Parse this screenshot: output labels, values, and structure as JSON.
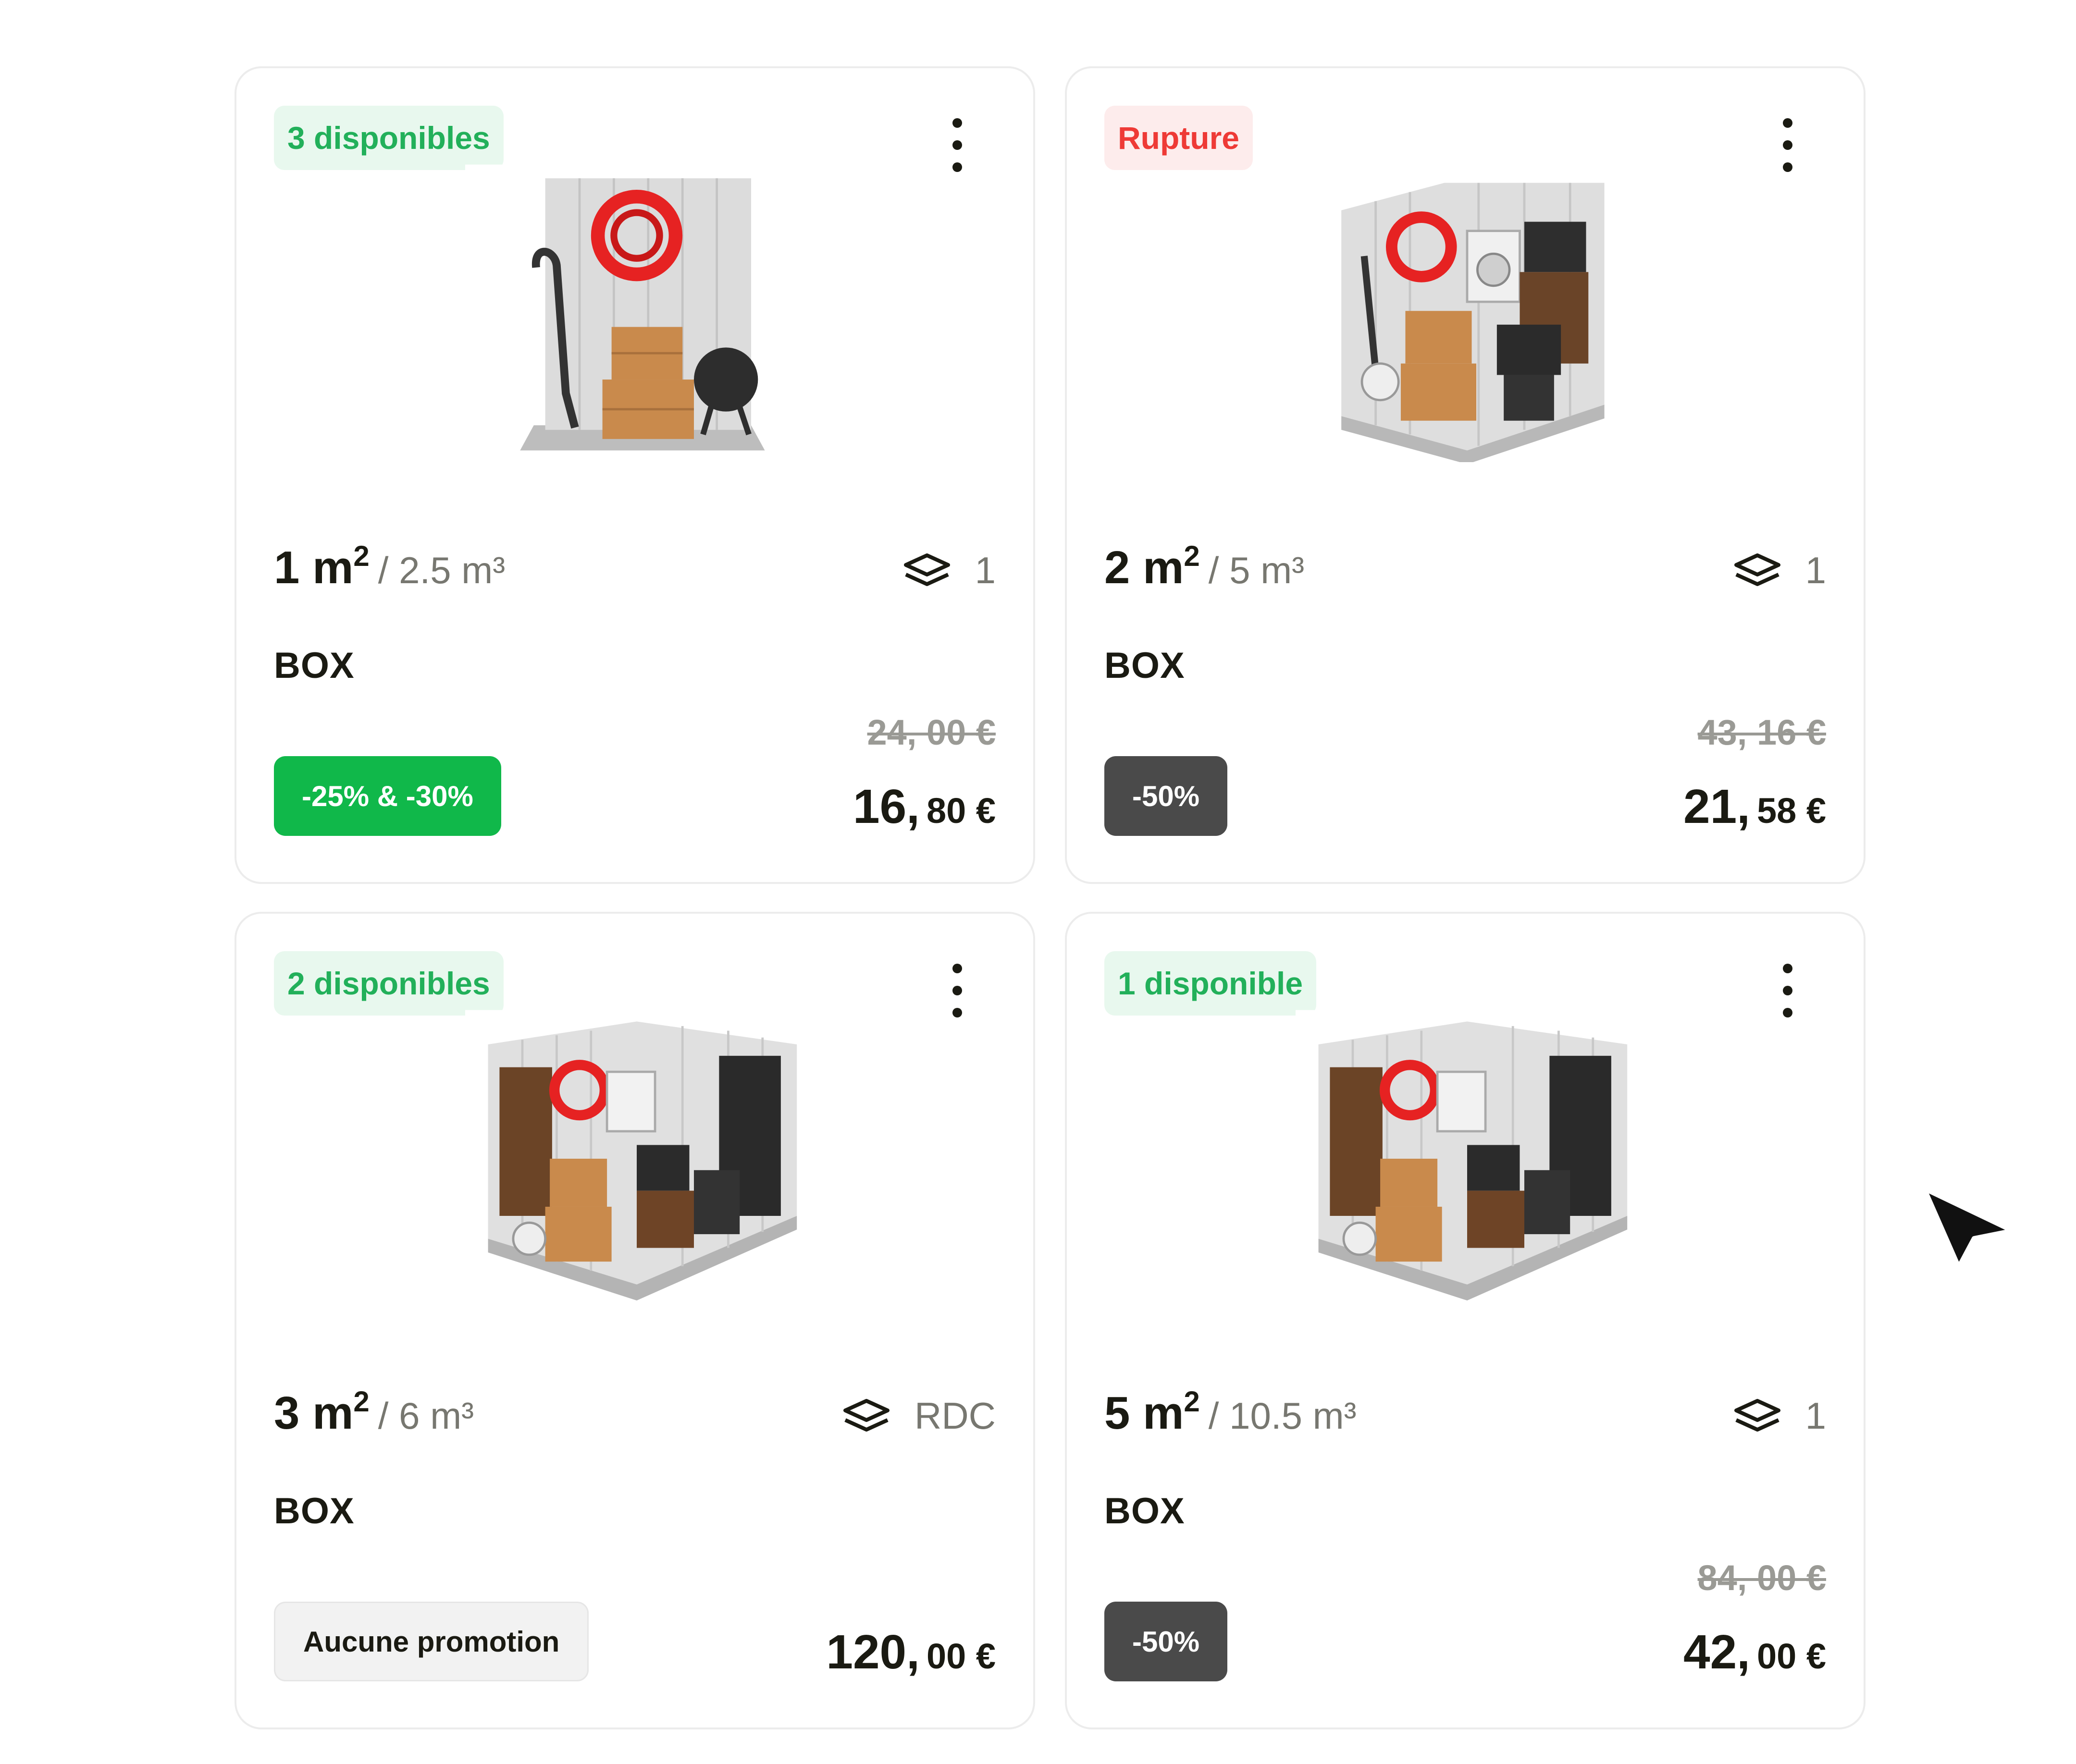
{
  "cards": [
    {
      "badge": "3 disponibles",
      "badge_status": "available",
      "area": "1 m",
      "area_sup": "2",
      "volume": "/ 2.5 m³",
      "level": "1",
      "type": "BOX",
      "old_price": "24, 00 €",
      "price_int": "16,",
      "price_dec": "80 €",
      "promo": "-25% & -30%",
      "promo_style": "green"
    },
    {
      "badge": "Rupture",
      "badge_status": "rupture",
      "area": "2 m",
      "area_sup": "2",
      "volume": "/ 5 m³",
      "level": "1",
      "type": "BOX",
      "old_price": "43, 16 €",
      "price_int": "21,",
      "price_dec": "58 €",
      "promo": "-50%",
      "promo_style": "dark"
    },
    {
      "badge": "2 disponibles",
      "badge_status": "available",
      "area": "3 m",
      "area_sup": "2",
      "volume": "/ 6 m³",
      "level": "RDC",
      "type": "BOX",
      "old_price": "",
      "price_int": "120,",
      "price_dec": "00 €",
      "promo": "Aucune promotion",
      "promo_style": "grey"
    },
    {
      "badge": "1 disponible",
      "badge_status": "available",
      "area": "5 m",
      "area_sup": "2",
      "volume": "/ 10.5 m³",
      "level": "1",
      "type": "BOX",
      "old_price": "84, 00 €",
      "price_int": "42,",
      "price_dec": "00 €",
      "promo": "-50%",
      "promo_style": "dark"
    }
  ],
  "colors": {
    "available_text": "#22b05a",
    "available_bg": "#e8f8ee",
    "rupture_text": "#ee3a36",
    "rupture_bg": "#fdecec",
    "promo_green": "#10b84a",
    "promo_dark": "#4a4a4a"
  },
  "icons": {
    "menu": "more-vertical-icon",
    "level": "layers-icon",
    "pointer": "cursor-arrow-icon"
  }
}
